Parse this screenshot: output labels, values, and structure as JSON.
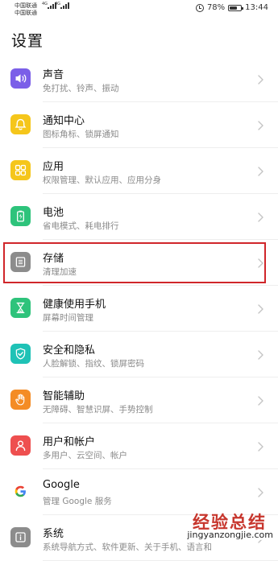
{
  "status_bar": {
    "carrier1": "中国联通",
    "carrier2": "中国联通",
    "carrier1_net": "4G",
    "carrier2_net": "4G",
    "battery": "78%",
    "battery_level": 0.78,
    "time": "13:44",
    "alarm_icon": "alarm-clock-icon",
    "battery_icon": "battery-icon"
  },
  "page": {
    "title": "设置"
  },
  "settings": [
    {
      "title": "声音",
      "subtitle": "免打扰、铃声、振动",
      "icon": "speaker-icon",
      "color": "#7b5fe8"
    },
    {
      "title": "通知中心",
      "subtitle": "图标角标、锁屏通知",
      "icon": "bell-icon",
      "color": "#f5c61b"
    },
    {
      "title": "应用",
      "subtitle": "权限管理、默认应用、应用分身",
      "icon": "apps-grid-icon",
      "color": "#f5c61b"
    },
    {
      "title": "电池",
      "subtitle": "省电模式、耗电排行",
      "icon": "battery-icon",
      "color": "#2ec37b"
    },
    {
      "title": "存储",
      "subtitle": "清理加速",
      "icon": "storage-icon",
      "color": "#8c8c8c"
    },
    {
      "title": "健康使用手机",
      "subtitle": "屏幕时间管理",
      "icon": "hourglass-icon",
      "color": "#2ec37b"
    },
    {
      "title": "安全和隐私",
      "subtitle": "人脸解锁、指纹、锁屏密码",
      "icon": "shield-check-icon",
      "color": "#1fc2b6"
    },
    {
      "title": "智能辅助",
      "subtitle": "无障碍、智慧识屏、手势控制",
      "icon": "hand-icon",
      "color": "#f48c25"
    },
    {
      "title": "用户和帐户",
      "subtitle": "多用户、云空间、帐户",
      "icon": "user-icon",
      "color": "#ee4f4f"
    },
    {
      "title": "Google",
      "subtitle": "管理 Google 服务",
      "icon": "google-icon",
      "color": "#ffffff"
    },
    {
      "title": "系统",
      "subtitle": "系统导航方式、软件更新、关于手机、语言和",
      "icon": "system-info-icon",
      "color": "#8c8c8c"
    }
  ],
  "highlight_color": "#d0262a",
  "watermark": {
    "main": "经验总结",
    "sub": "jingyanzongjie.com"
  }
}
